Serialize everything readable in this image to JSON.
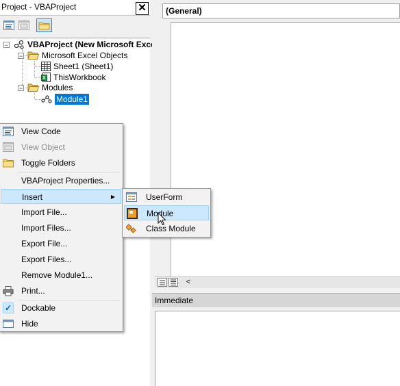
{
  "project": {
    "title": "Project - VBAProject",
    "close_label": "✕",
    "toolbar": {
      "view_code_icon": "view-code-icon",
      "view_object_icon": "view-object-icon",
      "toggle_folders_icon": "folder-icon"
    },
    "tree": {
      "root": "VBAProject (New Microsoft Exce",
      "excel_objects": "Microsoft Excel Objects",
      "sheet1": "Sheet1 (Sheet1)",
      "thisworkbook": "ThisWorkbook",
      "modules": "Modules",
      "module1": "Module1"
    }
  },
  "code": {
    "general": "(General)",
    "scroll_left": "<"
  },
  "immediate": {
    "title": "Immediate"
  },
  "context_menu": {
    "items": [
      {
        "label": "View Code"
      },
      {
        "label": "View Object"
      },
      {
        "label": "Toggle Folders"
      },
      {
        "label": "VBAProject Properties..."
      },
      {
        "label": "Insert"
      },
      {
        "label": "Import File..."
      },
      {
        "label": "Import Files..."
      },
      {
        "label": "Export File..."
      },
      {
        "label": "Export Files..."
      },
      {
        "label": "Remove Module1..."
      },
      {
        "label": "Print..."
      },
      {
        "label": "Dockable"
      },
      {
        "label": "Hide"
      }
    ]
  },
  "submenu": {
    "items": [
      {
        "label": "UserForm"
      },
      {
        "label": "Module"
      },
      {
        "label": "Class Module"
      }
    ]
  },
  "colors": {
    "selection": "#0078d7",
    "menu_highlight": "#cce8ff",
    "menu_highlight_border": "#99d1ff"
  }
}
